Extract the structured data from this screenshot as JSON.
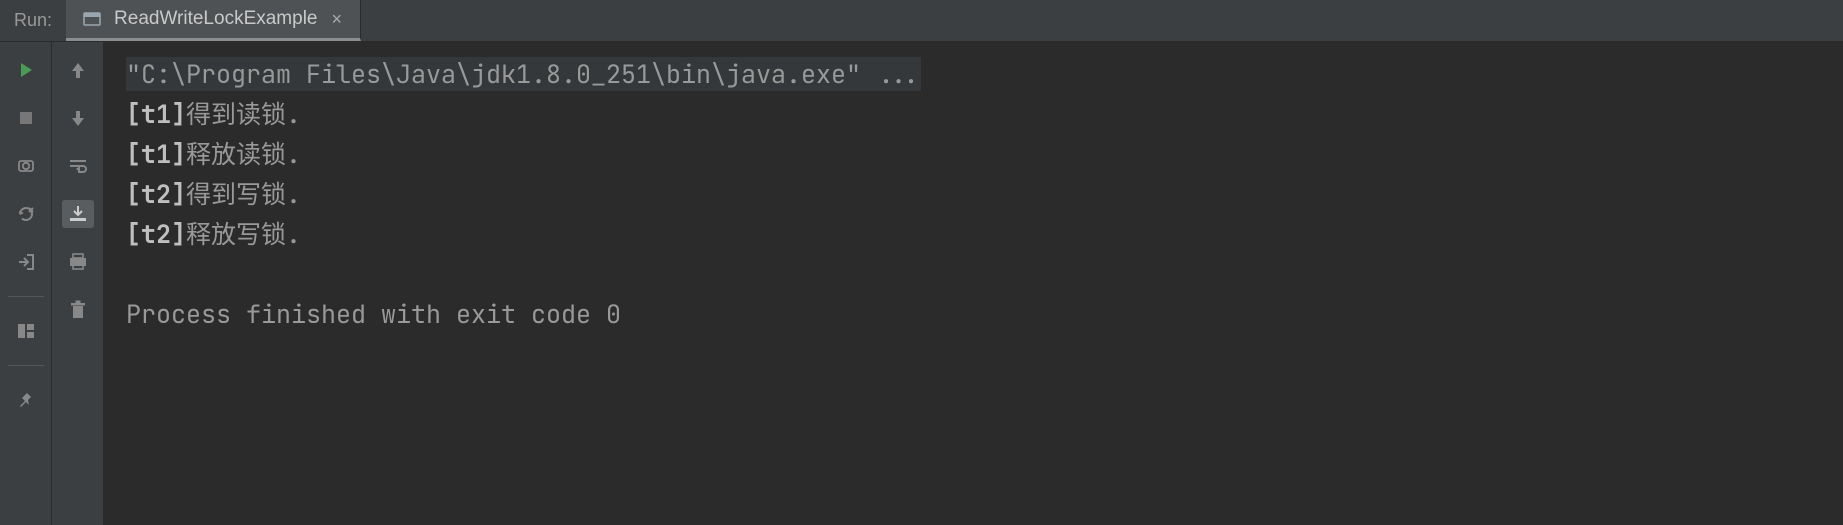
{
  "header": {
    "run_label": "Run:",
    "tab": {
      "title": "ReadWriteLockExample",
      "close": "×"
    }
  },
  "console": {
    "cmd": "\"C:\\Program Files\\Java\\jdk1.8.0_251\\bin\\java.exe\" ...",
    "lines": [
      {
        "prefix": "[t1]",
        "text": "得到读锁."
      },
      {
        "prefix": "[t1]",
        "text": "释放读锁."
      },
      {
        "prefix": "[t2]",
        "text": "得到写锁."
      },
      {
        "prefix": "[t2]",
        "text": "释放写锁."
      }
    ],
    "exit_msg": "Process finished with exit code 0"
  }
}
